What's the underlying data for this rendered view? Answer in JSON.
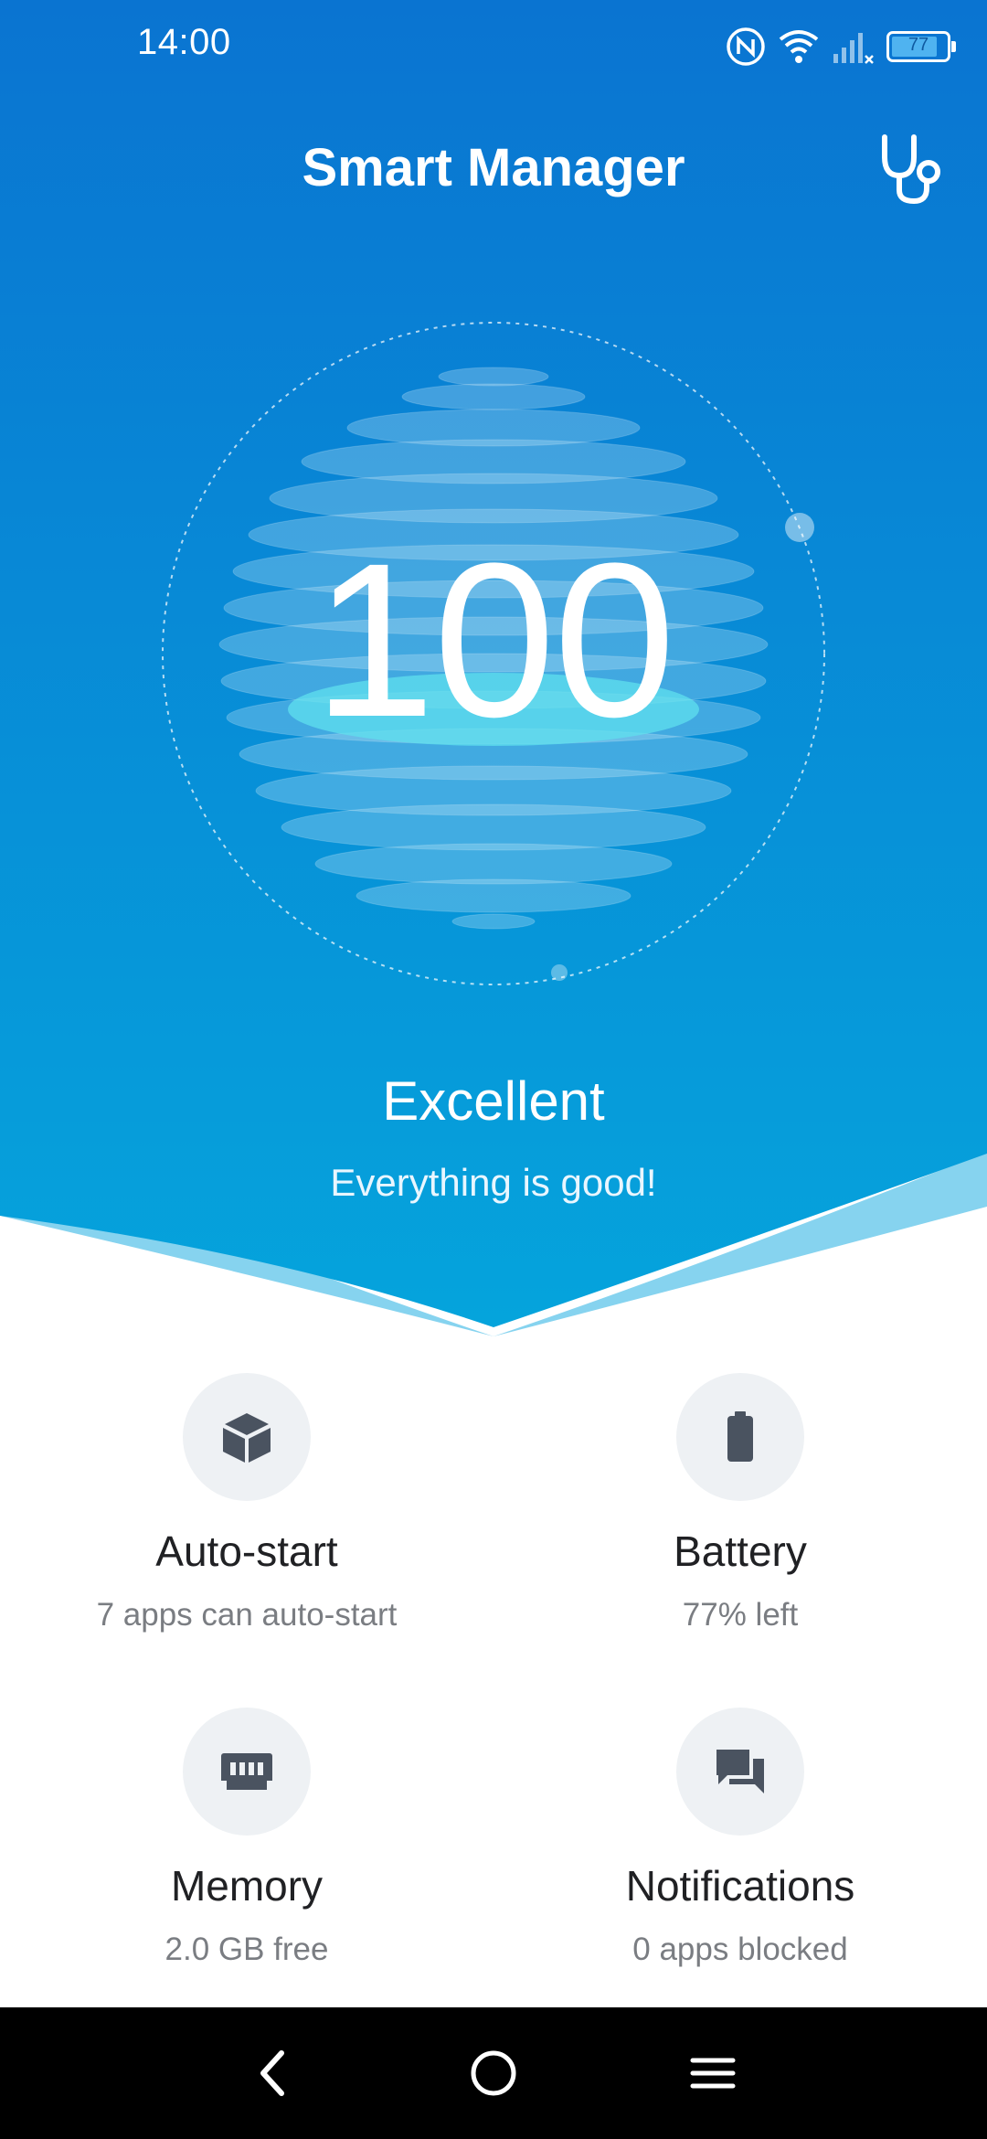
{
  "status_bar": {
    "time": "14:00",
    "battery_level": "77",
    "icons": [
      "nfc-icon",
      "wifi-icon",
      "signal-icon",
      "battery-icon"
    ]
  },
  "header": {
    "title": "Smart Manager",
    "diagnose_icon": "stethoscope-icon"
  },
  "health": {
    "score": "100",
    "status": "Excellent",
    "message": "Everything is good!"
  },
  "tiles": [
    {
      "label": "Auto-start",
      "sub": "7 apps can auto-start",
      "icon": "cube-icon"
    },
    {
      "label": "Battery",
      "sub": "77% left",
      "icon": "battery-icon"
    },
    {
      "label": "Memory",
      "sub": "2.0 GB free",
      "icon": "memory-chip-icon"
    },
    {
      "label": "Notifications",
      "sub": "0 apps blocked",
      "icon": "chat-icon"
    }
  ],
  "colors": {
    "hero_top": "#0a74d1",
    "hero_bottom": "#05a4dc",
    "wave_light": "#86d3ef",
    "icon": "#4a5360",
    "tile_circle": "#eef1f4"
  },
  "nav": {
    "back_icon": "back-icon",
    "home_icon": "home-icon",
    "menu_icon": "menu-icon"
  }
}
